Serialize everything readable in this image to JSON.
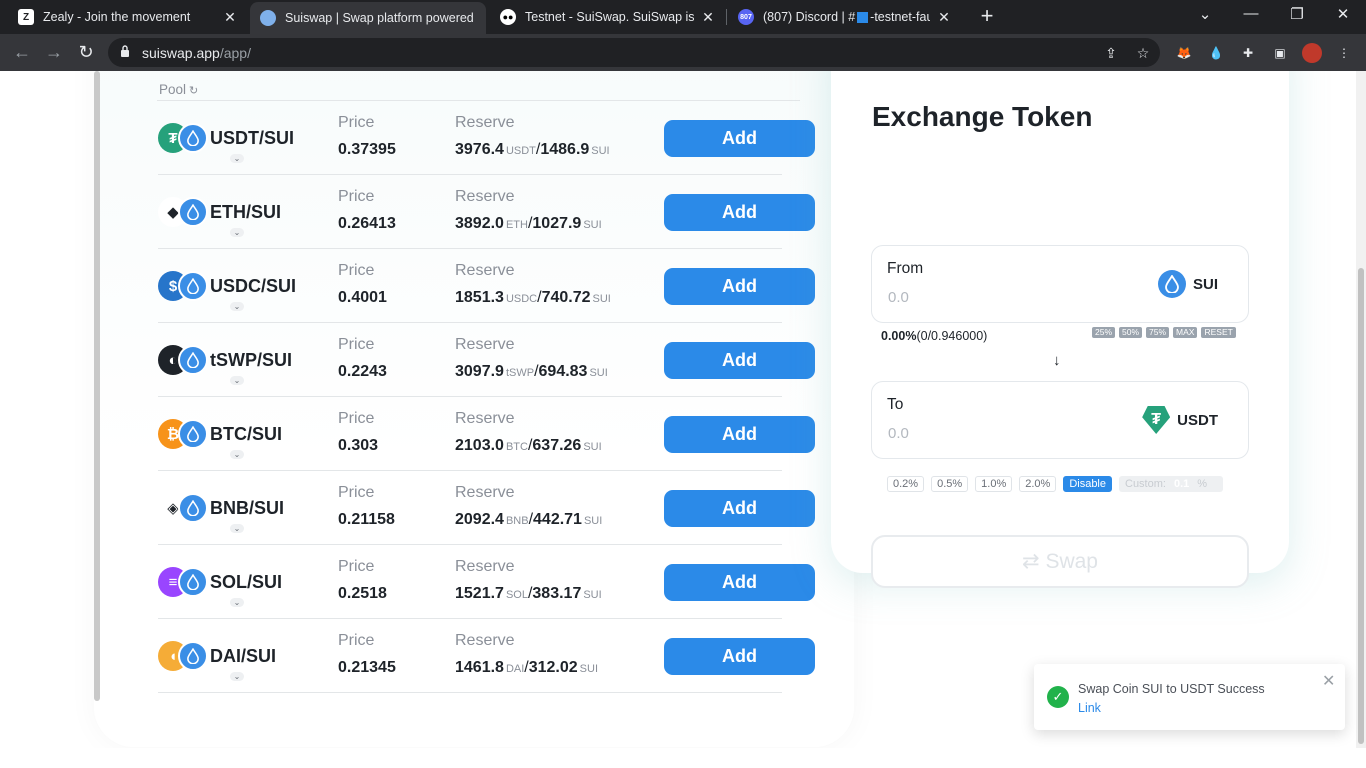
{
  "browser": {
    "tabs": [
      {
        "title": "Zealy - Join the movement",
        "favicon": "zealy-icon"
      },
      {
        "title": "Suiswap | Swap platform powered",
        "favicon": "suiswap-icon"
      },
      {
        "title": "Testnet - SuiSwap. SuiSwap is a Di",
        "favicon": "medium-icon"
      },
      {
        "title": "(807) Discord | #",
        "title_rest": "-testnet-fauc",
        "badge": "807",
        "favicon": "discord-icon"
      }
    ],
    "url_domain": "suiswap.app",
    "url_path": "/app/"
  },
  "pool": {
    "title": "Pool",
    "price_label": "Price",
    "reserve_label": "Reserve",
    "add_label": "Add",
    "rows": [
      {
        "pair": "USDT/SUI",
        "price": "0.37395",
        "res_a": "3976.4",
        "unit_a": "USDT",
        "res_b": "1486.9",
        "unit_b": "SUI",
        "color": "#26a17b",
        "glyph": "₮"
      },
      {
        "pair": "ETH/SUI",
        "price": "0.26413",
        "res_a": "3892.0",
        "unit_a": "ETH",
        "res_b": "1027.9",
        "unit_b": "SUI",
        "color": "#ffffff",
        "glyph": "◆"
      },
      {
        "pair": "USDC/SUI",
        "price": "0.4001",
        "res_a": "1851.3",
        "unit_a": "USDC",
        "res_b": "740.72",
        "unit_b": "SUI",
        "color": "#2775ca",
        "glyph": "$"
      },
      {
        "pair": "tSWP/SUI",
        "price": "0.2243",
        "res_a": "3097.9",
        "unit_a": "tSWP",
        "res_b": "694.83",
        "unit_b": "SUI",
        "color": "#1e2329",
        "glyph": "◐"
      },
      {
        "pair": "BTC/SUI",
        "price": "0.303",
        "res_a": "2103.0",
        "unit_a": "BTC",
        "res_b": "637.26",
        "unit_b": "SUI",
        "color": "#f7931a",
        "glyph": "₿"
      },
      {
        "pair": "BNB/SUI",
        "price": "0.21158",
        "res_a": "2092.4",
        "unit_a": "BNB",
        "res_b": "442.71",
        "unit_b": "SUI",
        "color": "#ffffff",
        "glyph": "◈"
      },
      {
        "pair": "SOL/SUI",
        "price": "0.2518",
        "res_a": "1521.7",
        "unit_a": "SOL",
        "res_b": "383.17",
        "unit_b": "SUI",
        "color": "#9945ff",
        "glyph": "≡"
      },
      {
        "pair": "DAI/SUI",
        "price": "0.21345",
        "res_a": "1461.8",
        "unit_a": "DAI",
        "res_b": "312.02",
        "unit_b": "SUI",
        "color": "#f5ac37",
        "glyph": "◖"
      }
    ]
  },
  "exchange": {
    "title": "Exchange Token",
    "from_label": "From",
    "from_placeholder": "0.0",
    "from_token": "SUI",
    "balance_pct": "0.00%",
    "balance_detail": "(0/0.946000)",
    "pct_buttons": [
      "25%",
      "50%",
      "75%",
      "MAX",
      "RESET"
    ],
    "arrow": "↓",
    "to_label": "To",
    "to_placeholder": "0.0",
    "to_token": "USDT",
    "slippage": [
      "0.2%",
      "0.5%",
      "1.0%",
      "2.0%",
      "Disable"
    ],
    "custom_label": "Custom:",
    "custom_value": "0.1",
    "custom_unit": "%",
    "swap_label": "⇄ Swap"
  },
  "toast": {
    "message": "Swap Coin SUI to USDT Success",
    "link": "Link"
  }
}
